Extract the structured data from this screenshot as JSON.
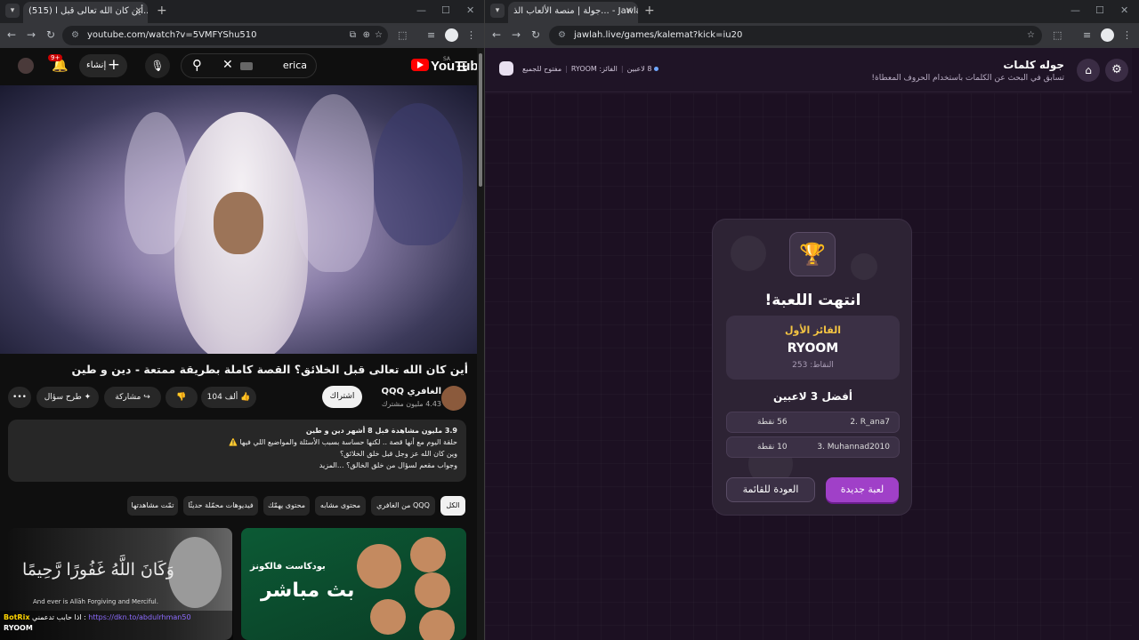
{
  "left_window": {
    "tab_title": "(515) أين كان الله تعالى قبل ا...",
    "url": "youtube.com/watch?v=5VMFYShu510",
    "youtube": {
      "logo": "YouTube",
      "region": "SA",
      "search_value": "erica",
      "create_label": "إنشاء",
      "notif_count": "9+",
      "video_title": "أين كان الله تعالى قبل الخلائق؟ القصة كاملة بطريقة ممتعة - دين و طين",
      "channel_name": "الغافري QQQ",
      "channel_subs": "4.43 مليون مشترك",
      "subscribe_label": "اشتراك",
      "likes": "104 ألف",
      "share_label": "مشاركة",
      "ask_label": "طرح سؤال",
      "description": {
        "meta": "3.9 مليون مشاهدة  قبل 8 أشهر  دين و طين",
        "line1": "حلقة اليوم مع أنها قصة .. لكنها حساسة بسبب الأسئلة والمواضيع اللي فيها ⚠️",
        "line2": "وين كان الله عز وجل قبل خلق الخلائق؟",
        "line3": "وجواب مقعم لسؤال من خلق الخالق؟ ...المزيد"
      },
      "chips": [
        "الكل",
        "من الغافري QQQ",
        "محتوى مشابه",
        "محتوى يهمّك",
        "فيديوهات محمّلة حديثًا",
        "تمّت مشاهدتها"
      ],
      "thumb1_text": "وَكَانَ اللَّهُ غَفُورًا رَّحِيمًا",
      "thumb1_caption": "And ever is Allāh Forgiving and Merciful.",
      "thumb2_small": "بودكاست فالكونز",
      "thumb2_big": "بث مباشر"
    },
    "chat_overlay": {
      "line1_user": "BotRix",
      "line1_msg": "اذا حابب تدعمني :",
      "line1_url": "https://dkn.to/abdulrhman50",
      "line2_user": "RYOOM"
    },
    "icons": {
      "bell": "bell-icon",
      "search": "search-icon",
      "mic": "mic-icon",
      "menu": "hamburger-icon"
    }
  },
  "right_window": {
    "tab_title": "جولة | منصة الألعاب الذ... - Jawlah",
    "url": "jawlah.live/games/kalemat?kick=iu20",
    "header": {
      "title": "جوله كلمات",
      "subtitle": "تسابق في البحث عن الكلمات باستخدام الحروف المعطاة!",
      "players": "8 لاعبين",
      "winner": "الفائز: RYOOM",
      "open": "مفتوح للجميع"
    },
    "result": {
      "ended": "انتهت اللعبة!",
      "winner_label": "الفائز الأول",
      "winner_name": "RYOOM",
      "winner_points": "النقاط: 253",
      "top3_title": "أفضل 3 لاعبين",
      "rows": [
        {
          "name": "2. R_ana7",
          "points": "56 نقطة"
        },
        {
          "name": "3. Muhannad2010",
          "points": "10 نقطة"
        }
      ],
      "new_game": "لعبة جديدة",
      "back": "العودة للقائمة"
    },
    "colors": {
      "accent": "#a040c8",
      "gold": "#f5c542"
    }
  }
}
